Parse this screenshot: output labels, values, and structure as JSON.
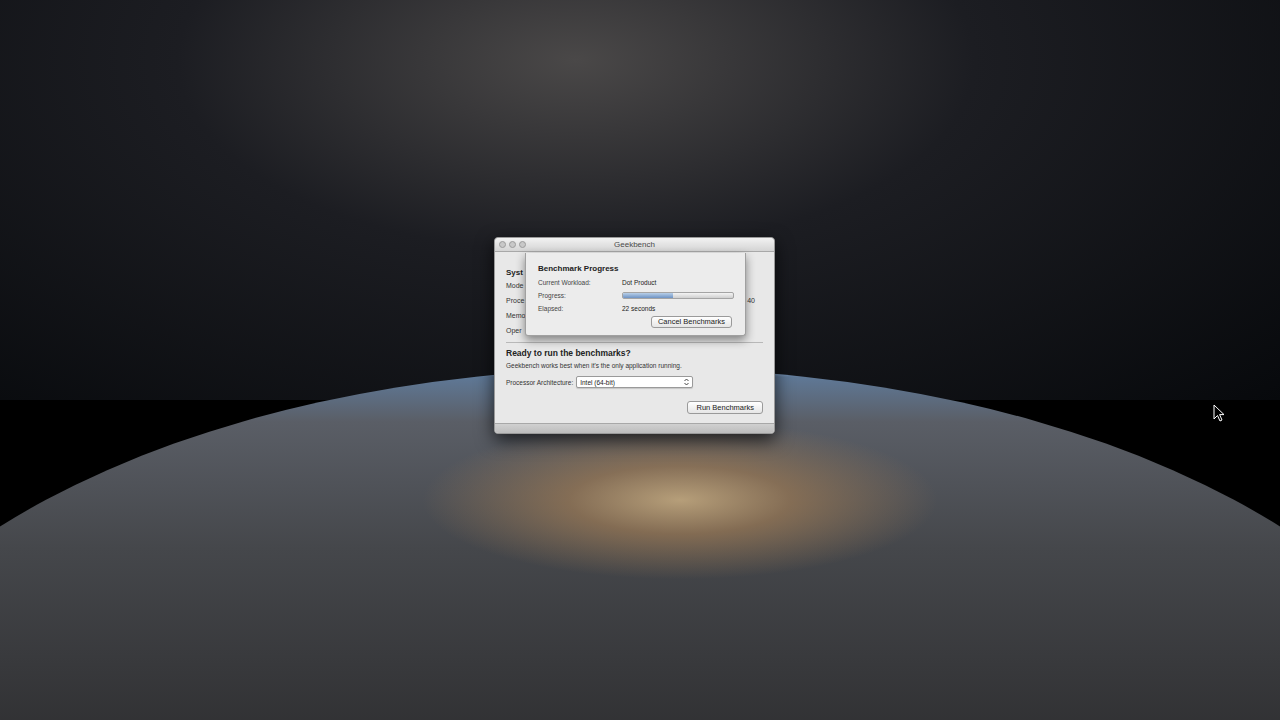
{
  "window": {
    "title": "Geekbench"
  },
  "system_info": {
    "heading": "Syst",
    "labels": [
      "Mode",
      "Proce",
      "Memo",
      "Oper"
    ],
    "processor_tail": "40"
  },
  "ready": {
    "heading": "Ready to run the benchmarks?",
    "hint": "Geekbench works best when it's the only application running.",
    "arch_label": "Processor Architecture:",
    "arch_value": "Intel (64-bit)",
    "run_button": "Run Benchmarks"
  },
  "progress_sheet": {
    "title": "Benchmark Progress",
    "workload_label": "Current Workload:",
    "workload": "Dot Product",
    "progress_label": "Progress:",
    "level": 0.45,
    "elapsed_label": "Elapsed:",
    "elapsed": "22 seconds",
    "cancel_button": "Cancel Benchmarks"
  }
}
